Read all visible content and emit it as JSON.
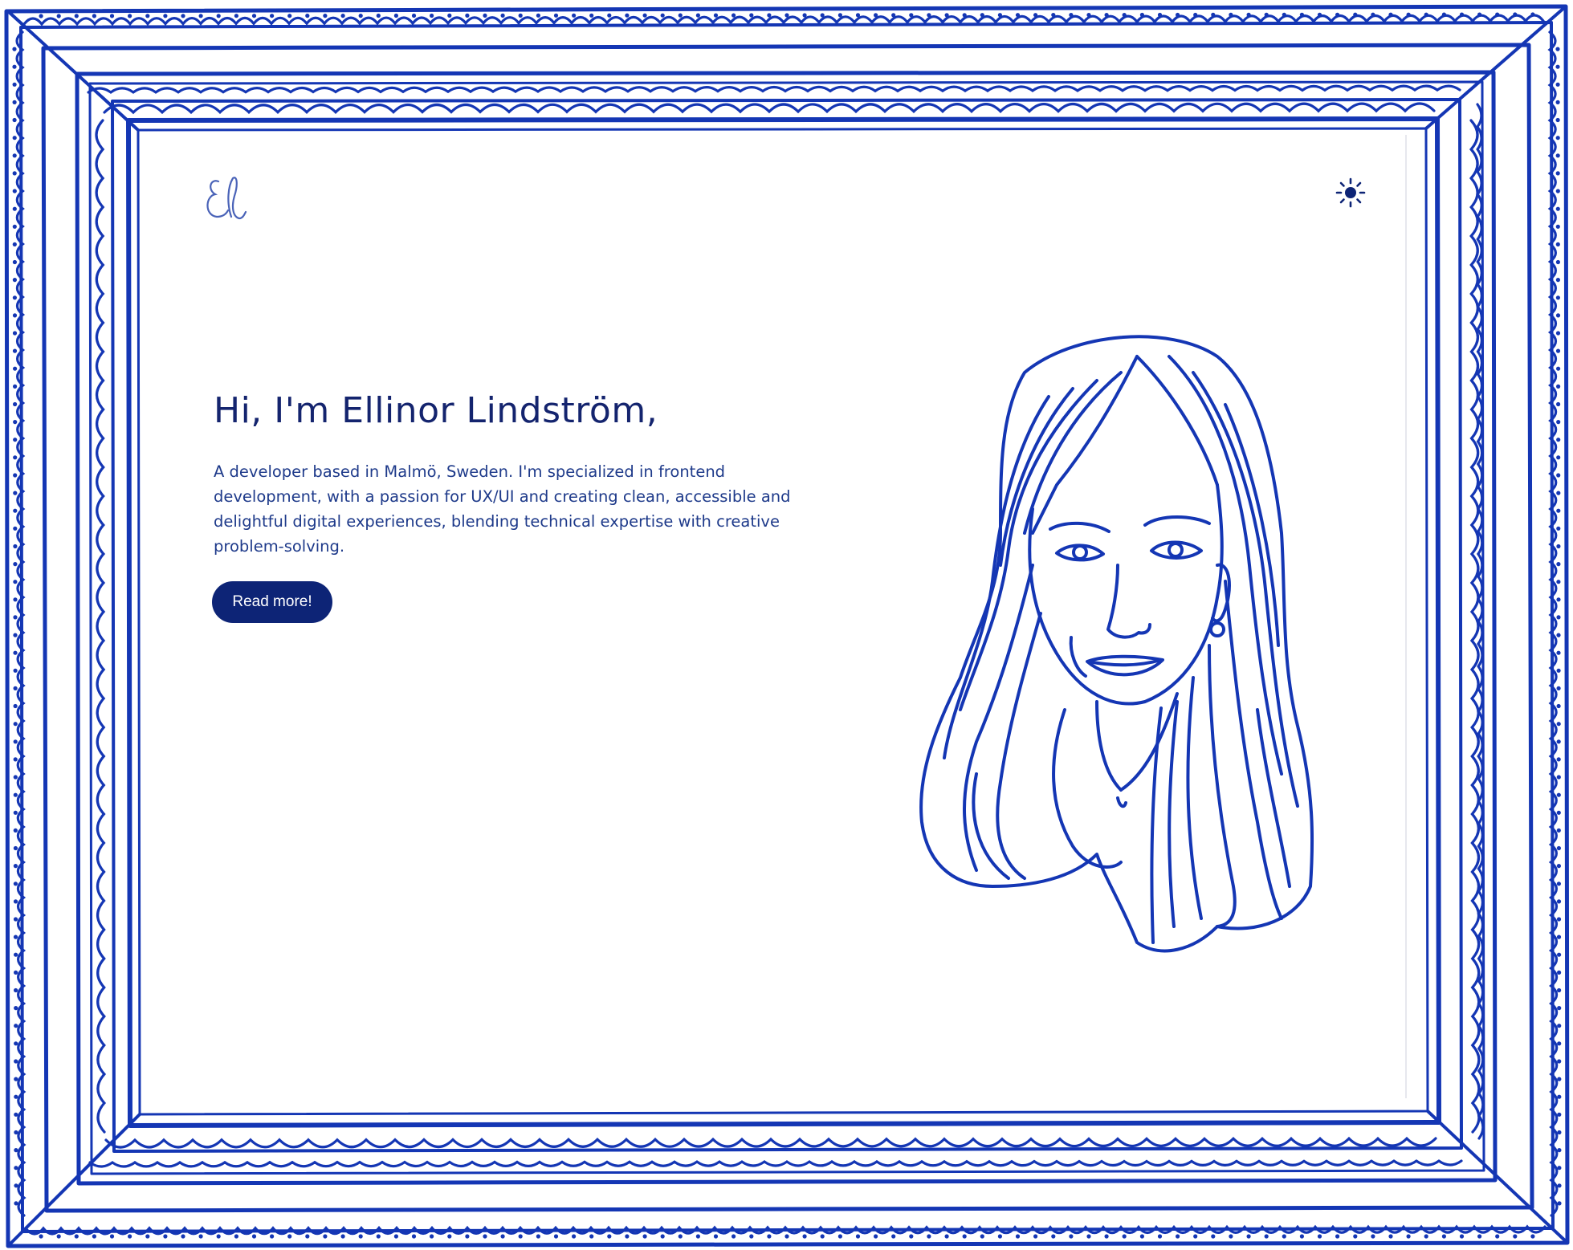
{
  "logo": {
    "text": "El"
  },
  "theme_toggle": {
    "icon": "sun-icon"
  },
  "hero": {
    "title": "Hi, I'm Ellinor Lindström,",
    "description": "A developer based in Malmö, Sweden. I'm specialized in frontend development, with a passion for UX/UI and creating clean, accessible and delightful digital experiences, blending technical expertise with creative problem-solving.",
    "button_label": "Read more!"
  },
  "illustration": {
    "subject": "portrait-illustration"
  },
  "colors": {
    "frame": "#1436b4",
    "heading": "#14246e",
    "text": "#1e3a8a",
    "button": "#0d2476",
    "button_text": "#ffffff"
  }
}
